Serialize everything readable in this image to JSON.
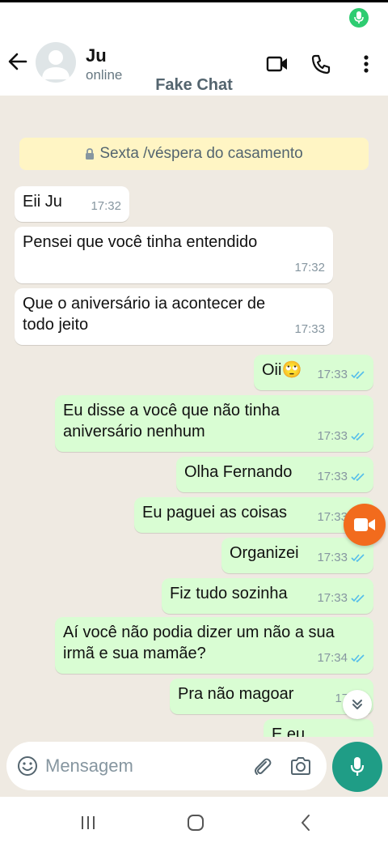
{
  "app": {
    "watermark": "Fake Chat"
  },
  "contact": {
    "name": "Ju",
    "status": "online"
  },
  "header_icons": [
    "back-arrow-icon",
    "video-call-icon",
    "phone-icon",
    "more-vert-icon"
  ],
  "date_chip": "Sexta /véspera do casamento",
  "messages": [
    {
      "dir": "in",
      "text": "Eii Ju",
      "time": "17:32"
    },
    {
      "dir": "in",
      "text": "Pensei que você tinha entendido",
      "time": "17:32"
    },
    {
      "dir": "in",
      "text": "Que o aniversário ia acontecer de todo jeito",
      "time": "17:33"
    },
    {
      "dir": "out",
      "text": "Oii🙄",
      "time": "17:33",
      "status": "read"
    },
    {
      "dir": "out",
      "text": "Eu disse a você que não tinha aniversário nenhum",
      "time": "17:33",
      "status": "read"
    },
    {
      "dir": "out",
      "text": "Olha Fernando",
      "time": "17:33",
      "status": "read"
    },
    {
      "dir": "out",
      "text": "Eu paguei as coisas",
      "time": "17:33",
      "status": "read"
    },
    {
      "dir": "out",
      "text": "Organizei",
      "time": "17:33",
      "status": "read"
    },
    {
      "dir": "out",
      "text": "Fiz tudo sozinha",
      "time": "17:33",
      "status": "read"
    },
    {
      "dir": "out",
      "text": "Aí você não podia dizer um não a sua irmã e sua mamãe?",
      "time": "17:34",
      "status": "read"
    },
    {
      "dir": "out",
      "text": "Pra não magoar",
      "time": "17:34",
      "status": "read"
    },
    {
      "dir": "out",
      "text": "E eu",
      "time": "",
      "status": ""
    }
  ],
  "composer": {
    "placeholder": "Mensagem"
  },
  "colors": {
    "accent": "#1f9d86",
    "outgoing_bubble": "#d9fdd3",
    "read_ticks": "#53bdeb",
    "video_fab": "#f26b1d"
  }
}
